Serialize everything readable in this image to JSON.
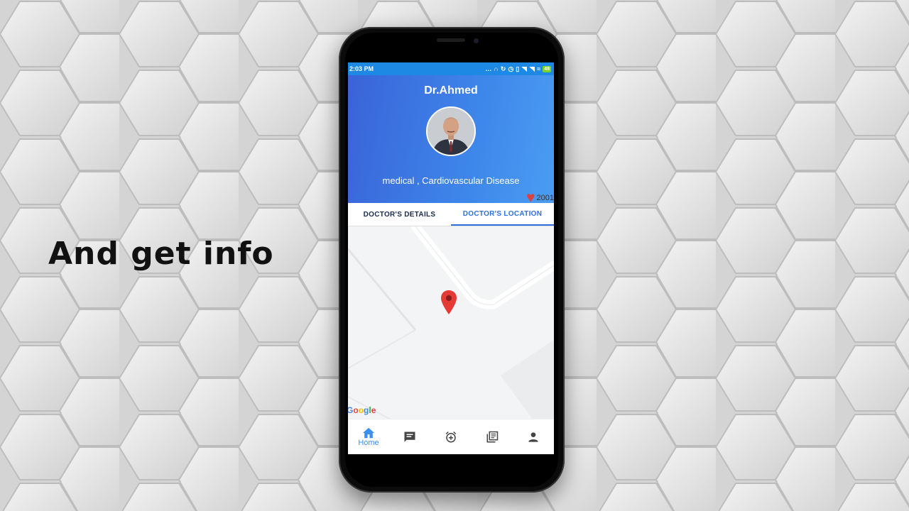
{
  "promo": {
    "caption": "And get info"
  },
  "status_bar": {
    "time": "2:03 PM",
    "battery": "48"
  },
  "doctor": {
    "name": "Dr.Ahmed",
    "specialty": "medical , Cardiovascular Disease",
    "likes": "2001"
  },
  "tabs": [
    {
      "label": "DOCTOR'S DETAILS",
      "active": false
    },
    {
      "label": "DOCTOR'S LOCATION",
      "active": true
    }
  ],
  "map": {
    "attribution": "Google",
    "pin_icon": "map-pin-icon"
  },
  "bottom_nav": [
    {
      "icon": "home-icon",
      "label": "Home",
      "active": true
    },
    {
      "icon": "chat-icon",
      "label": "",
      "active": false
    },
    {
      "icon": "alarm-add-icon",
      "label": "",
      "active": false
    },
    {
      "icon": "library-books-icon",
      "label": "",
      "active": false
    },
    {
      "icon": "person-icon",
      "label": "",
      "active": false
    }
  ],
  "colors": {
    "accent": "#3b8ff0",
    "header_start": "#3a63d8",
    "header_end": "#4a9df2",
    "pin": "#e53935",
    "heart": "#e0403a"
  }
}
